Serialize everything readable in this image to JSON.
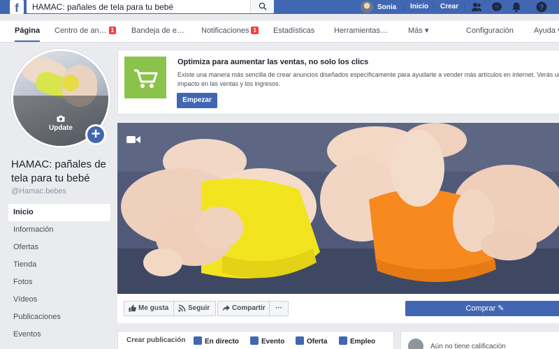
{
  "topbar": {
    "logo": "f",
    "search_value": "HAMAC: pañales de tela para tu bebé",
    "user_name": "Sonia",
    "links": [
      "Inicio",
      "Crear"
    ],
    "icons": [
      "friends-icon",
      "messenger-icon",
      "bell-icon",
      "help-icon"
    ]
  },
  "nav": {
    "items": [
      {
        "label": "Página"
      },
      {
        "label": "Centro de an…",
        "badge": "1"
      },
      {
        "label": "Bandeja de e…"
      },
      {
        "label": "Notificaciones",
        "badge": "1"
      },
      {
        "label": "Estadísticas"
      },
      {
        "label": "Herramientas…"
      },
      {
        "label": "Más ▾"
      },
      {
        "label": "Configuración"
      },
      {
        "label": "Ayuda ▾"
      }
    ]
  },
  "profile": {
    "update_label": "Update",
    "add_label": "+",
    "name": "HAMAC: pañales de tela para tu bebé",
    "handle": "@Hamac.bebes"
  },
  "sidebar": {
    "items": [
      {
        "label": "Inicio"
      },
      {
        "label": "Información"
      },
      {
        "label": "Ofertas"
      },
      {
        "label": "Tienda"
      },
      {
        "label": "Fotos"
      },
      {
        "label": "Vídeos"
      },
      {
        "label": "Publicaciones"
      },
      {
        "label": "Eventos"
      }
    ]
  },
  "promo": {
    "title": "Optimiza para aumentar las ventas, no solo los clics",
    "text": "Existe una manera más sencilla de crear anuncios diseñados específicamente para ayudarte a vender más artículos en internet. Verás un impacto en las ventas y los ingresos.",
    "button": "Empezar"
  },
  "actions": {
    "like": "Me gusta",
    "follow": "Seguir",
    "share": "Compartir",
    "more": "···",
    "buy": "Comprar ✎"
  },
  "create": {
    "label": "Crear publicación",
    "items": [
      "En directo",
      "Evento",
      "Oferta",
      "Empleo"
    ]
  },
  "rating": {
    "text": "Aún no tiene calificación"
  },
  "colors": {
    "brand": "#4267b2",
    "badge": "#fa3e3e",
    "promo_image": "#8bc34a"
  }
}
